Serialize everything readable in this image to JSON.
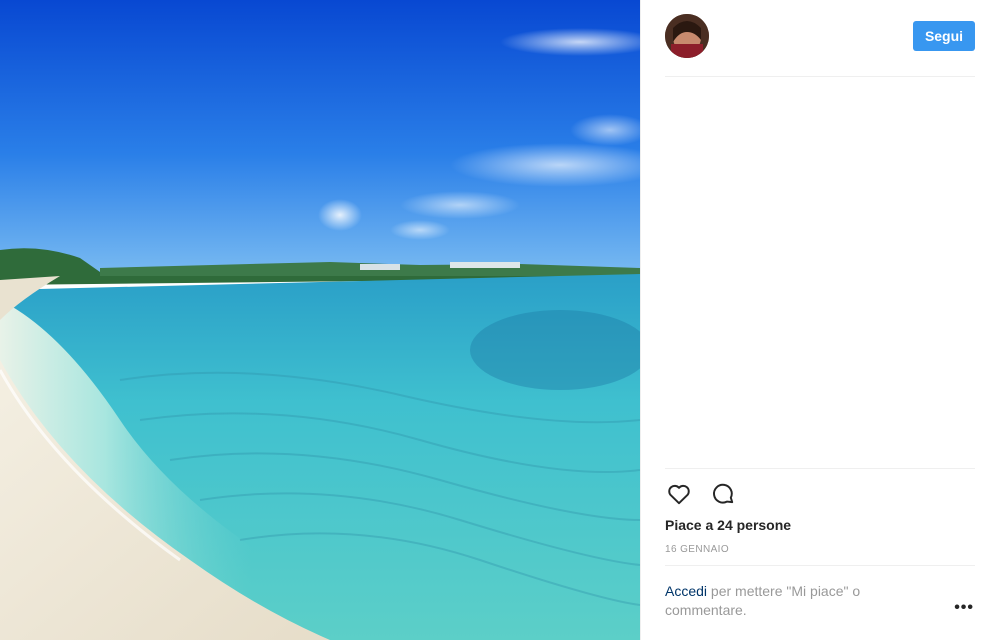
{
  "header": {
    "username": "",
    "follow_label": "Segui"
  },
  "photo": {
    "subject": "beach-with-turquoise-sea",
    "colors": {
      "sky_top": "#0a4fd6",
      "sky_horizon": "#6fb4f0",
      "sea_deep": "#1fa6c4",
      "sea_shallow": "#7fe0dc",
      "sand": "#f1ece0"
    }
  },
  "actions": {
    "like_icon": "heart-icon",
    "comment_icon": "comment-icon"
  },
  "likes_text": "Piace a 24 persone",
  "date_text": "16 GENNAIO",
  "login_prompt": {
    "link_text": "Accedi",
    "rest_text": " per mettere \"Mi piace\" o commentare."
  },
  "more_label": "•••",
  "colors": {
    "accent": "#3897f0",
    "link": "#003569",
    "muted": "#999999",
    "text": "#262626",
    "divider": "#efefef"
  }
}
